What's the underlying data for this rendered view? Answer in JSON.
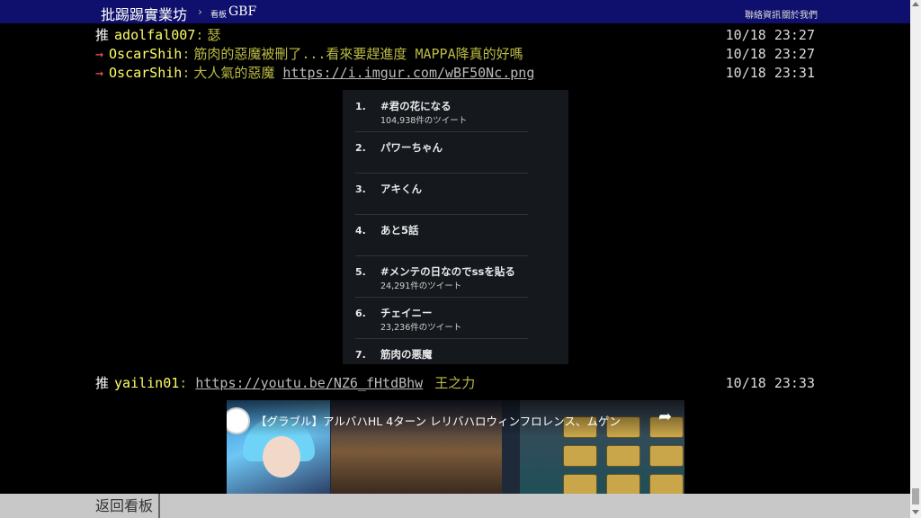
{
  "topbar": {
    "brand": "批踢踢實業坊",
    "separator": "›",
    "board_label": "看板",
    "board_name": "GBF",
    "links": [
      "聯絡資訊",
      "關於我們"
    ]
  },
  "comments": [
    {
      "tag": "推",
      "user": "adolfal007",
      "content": "瑟",
      "link": "",
      "time": "10/18 23:27"
    },
    {
      "tag": "→",
      "user": "OscarShih",
      "content": "筋肉的惡魔被刪了...看來要趕進度 MAPPA降真的好嗎",
      "link": "",
      "time": "10/18 23:27"
    },
    {
      "tag": "→",
      "user": "OscarShih",
      "content": "大人氣的惡魔",
      "link": "https://i.imgur.com/wBF50Nc.png",
      "time": "10/18 23:31"
    },
    {
      "tag": "推",
      "user": "yailin01",
      "content": "王之力",
      "link": "https://youtu.be/NZ6_fHtdBhw",
      "time": "10/18 23:33"
    }
  ],
  "trending": [
    {
      "rank": "1.",
      "name": "#君の花になる",
      "count": "104,938件のツイート"
    },
    {
      "rank": "2.",
      "name": "パワーちゃん",
      "count": ""
    },
    {
      "rank": "3.",
      "name": "アキくん",
      "count": ""
    },
    {
      "rank": "4.",
      "name": "あと5話",
      "count": ""
    },
    {
      "rank": "5.",
      "name": "#メンテの日なのでssを貼る",
      "count": "24,291件のツイート"
    },
    {
      "rank": "6.",
      "name": "チェイニー",
      "count": "23,236件のツイート"
    },
    {
      "rank": "7.",
      "name": "筋肉の悪魔",
      "count": ""
    }
  ],
  "youtube": {
    "title": "【グラブル】アルバハHL 4ターン レリバハロウィンフロレンス、ムゲン",
    "share_icon": "share-arrow-icon"
  },
  "bottombar": {
    "back_label": "返回看板"
  },
  "colors": {
    "topbar": "#0f0f6e",
    "push_user": "#ffff66",
    "push_content": "#bbbb44",
    "arrow": "#ff5555"
  }
}
